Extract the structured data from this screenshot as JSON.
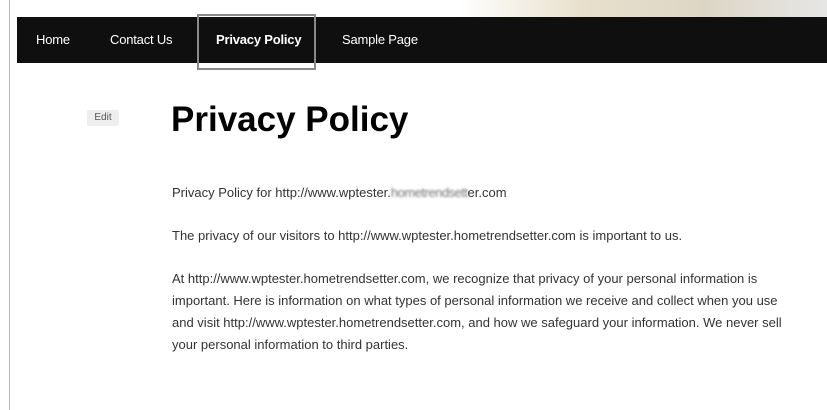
{
  "nav": {
    "items": [
      {
        "label": "Home",
        "active": false
      },
      {
        "label": "Contact Us",
        "active": false
      },
      {
        "label": "Privacy Policy",
        "active": true
      },
      {
        "label": "Sample Page",
        "active": false
      }
    ]
  },
  "edit_label": "Edit",
  "page_title": "Privacy Policy",
  "content": {
    "p1_prefix": "Privacy Policy for http://www.wptester.",
    "p1_blurred": "hometrendsett",
    "p1_suffix": "er.com",
    "p2": "The privacy of our visitors to http://www.wptester.hometrendsetter.com is important to us.",
    "p3": "At http://www.wptester.hometrendsetter.com, we recognize that privacy of your personal information is important. Here is information on what types of personal information we receive and collect when you use and visit http://www.wptester.hometrendsetter.com, and how we safeguard your information. We never sell your personal information to third parties."
  },
  "colors": {
    "navbar_bg": "#0f0f0f",
    "nav_text": "#ffffff",
    "highlight_border": "#8a8a8a",
    "body_text": "#333333",
    "title_text": "#000000"
  }
}
